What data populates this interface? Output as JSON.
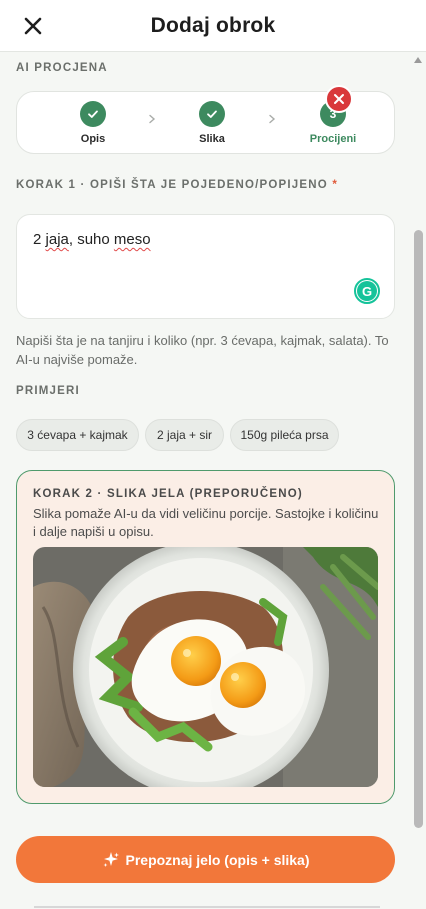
{
  "header": {
    "title": "Dodaj obrok"
  },
  "sections": {
    "ai_label": "AI PROCJENA",
    "step1_label": "KORAK 1 · OPIŠI ŠTA JE POJEDENO/POPIJENO",
    "required_mark": "*",
    "examples_label": "PRIMJERI"
  },
  "stepper": {
    "steps": [
      {
        "label": "Opis",
        "state": "done",
        "number": ""
      },
      {
        "label": "Slika",
        "state": "done",
        "number": ""
      },
      {
        "label": "Procijeni",
        "state": "active",
        "number": "3"
      }
    ]
  },
  "description": {
    "value_prefix": "2 ",
    "value_word1": "jaja",
    "value_mid": ", suho ",
    "value_word2": "meso",
    "hint": "Napiši šta je na tanjiru i koliko (npr. 3 ćevapa, kajmak, salata). To AI-u najviše pomaže."
  },
  "examples": [
    "3 ćevapa + kajmak",
    "2 jaja + sir",
    "150g pileća prsa"
  ],
  "photo_section": {
    "title": "KORAK 2 · SLIKA JELA (PREPORUČENO)",
    "description": "Slika pomaže AI-u da vidi veličinu porcije. Sastojke i količinu i dalje napiši u opisu.",
    "remove_icon": "close-icon"
  },
  "cta": {
    "label": "Prepoznaj jelo (opis + slika)",
    "icon": "sparkle-icon"
  },
  "colors": {
    "accent_green": "#3d8a5f",
    "cta_orange": "#f2773a",
    "remove_red": "#d9383b"
  }
}
